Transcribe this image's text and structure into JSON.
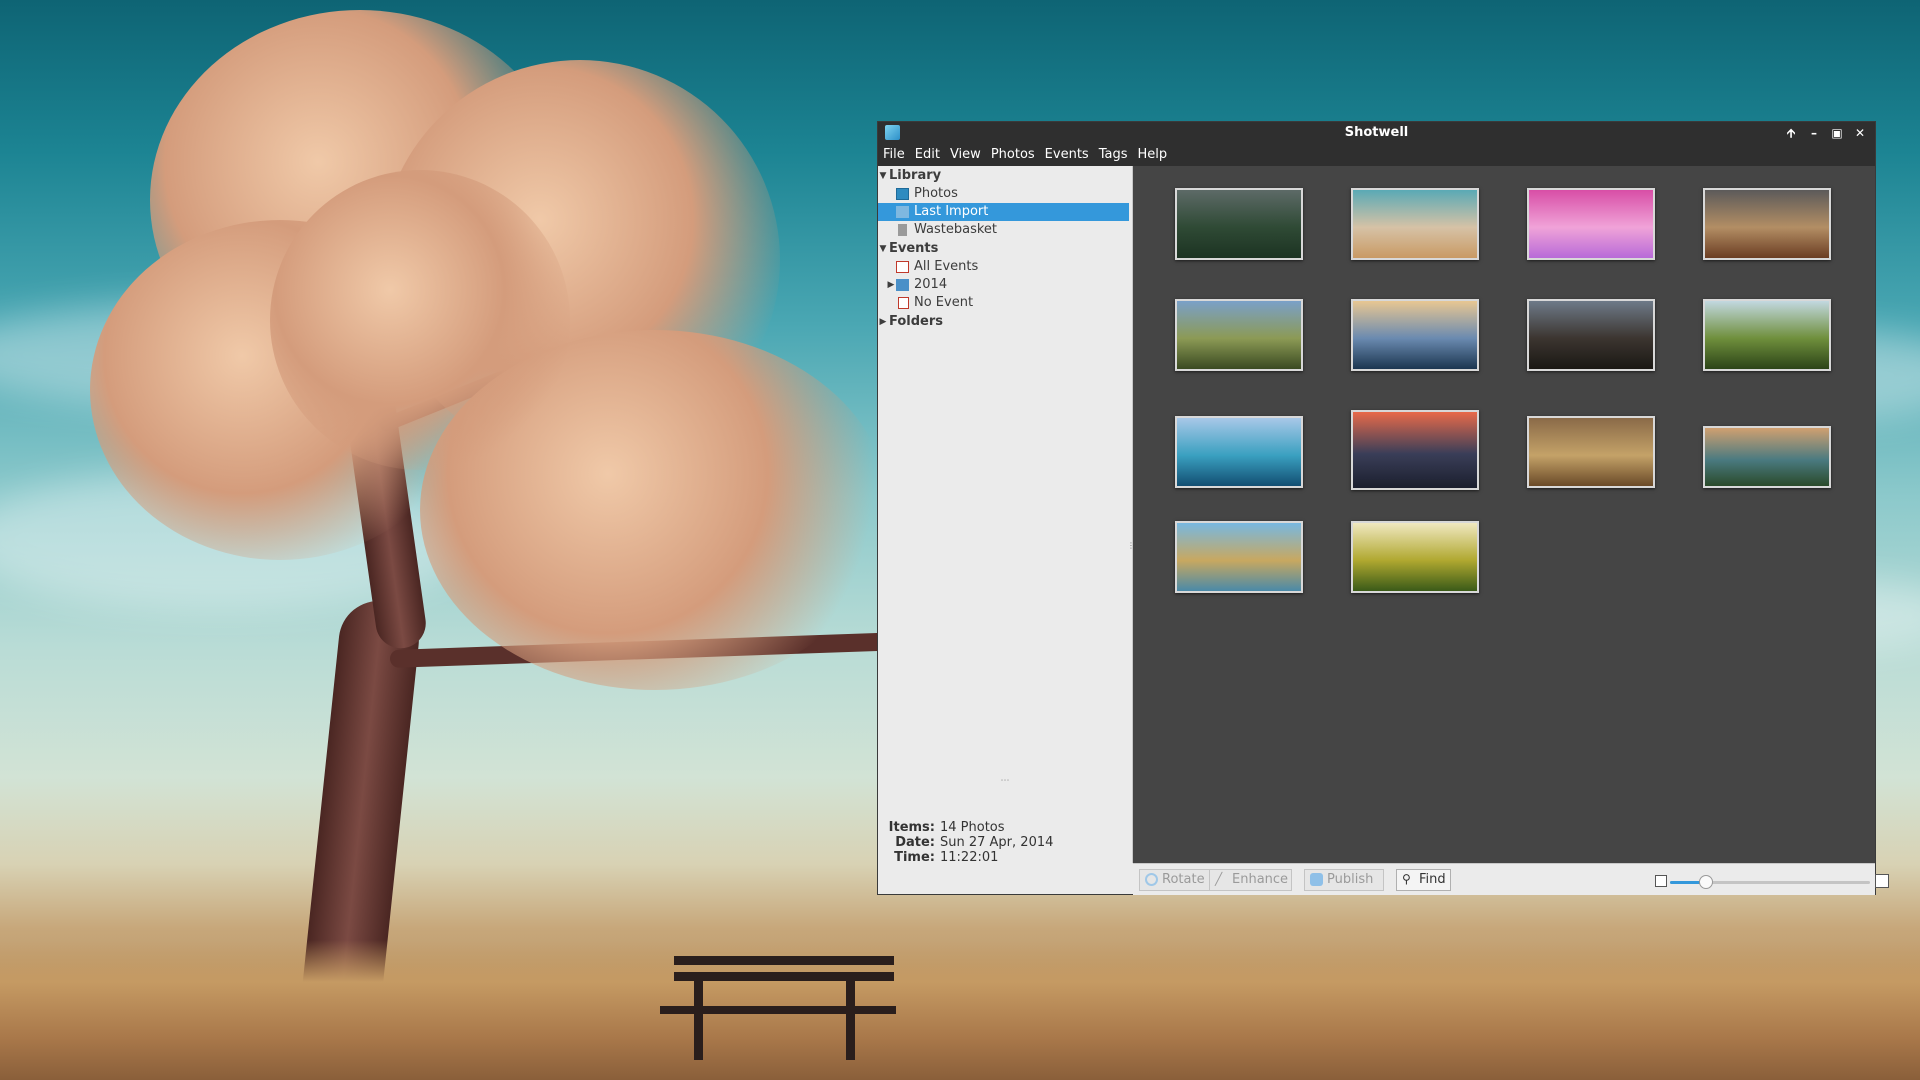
{
  "window": {
    "title": "Shotwell",
    "controls": [
      "keep-above",
      "minimize",
      "maximize",
      "close"
    ]
  },
  "menu": [
    "File",
    "Edit",
    "View",
    "Photos",
    "Events",
    "Tags",
    "Help"
  ],
  "sidebar": {
    "library_label": "Library",
    "library_items": [
      "Photos",
      "Last Import",
      "Wastebasket"
    ],
    "selected": "Last Import",
    "events_label": "Events",
    "events_items": [
      "All Events",
      "2014",
      "No Event"
    ],
    "folders_label": "Folders"
  },
  "info": {
    "items_label": "Items:",
    "items_value": "14 Photos",
    "date_label": "Date:",
    "date_value": "Sun 27 Apr, 2014",
    "time_label": "Time:",
    "time_value": "11:22:01"
  },
  "photos": [
    {
      "name": "misty-forest",
      "colors": [
        "#5d6a67",
        "#2f4a35",
        "#1c3322"
      ]
    },
    {
      "name": "tree-bench",
      "colors": [
        "#5aa9b5",
        "#d6c2a6",
        "#c99a64"
      ]
    },
    {
      "name": "colorful-droplets",
      "colors": [
        "#d84ea6",
        "#f0a3d8",
        "#b86ad8"
      ]
    },
    {
      "name": "canyon-sunset",
      "colors": [
        "#5c5a5a",
        "#b38e64",
        "#6b3d23"
      ]
    },
    {
      "name": "waterfall",
      "colors": [
        "#7aa0c8",
        "#8c9a55",
        "#3a4a22"
      ]
    },
    {
      "name": "rocky-shore",
      "colors": [
        "#e8c792",
        "#6a8ab0",
        "#1c3650"
      ]
    },
    {
      "name": "stormy-cliff",
      "colors": [
        "#6e7a88",
        "#3c3530",
        "#1a1814"
      ]
    },
    {
      "name": "green-valley",
      "colors": [
        "#c2d8e0",
        "#6f8f3c",
        "#2c4418"
      ]
    },
    {
      "name": "mountain-lake",
      "colors": [
        "#a8c8e8",
        "#3aa0c0",
        "#124e72"
      ]
    },
    {
      "name": "city-skyline",
      "colors": [
        "#e86a4a",
        "#3a3e58",
        "#1b1f2e"
      ]
    },
    {
      "name": "desert-storm",
      "colors": [
        "#8a6a48",
        "#c4a268",
        "#6a4a28"
      ]
    },
    {
      "name": "river-valley",
      "colors": [
        "#d0a070",
        "#4a7a80",
        "#2a4a2a"
      ]
    },
    {
      "name": "alpine-reflection",
      "colors": [
        "#78b8e0",
        "#c8a860",
        "#4a8aa8"
      ]
    },
    {
      "name": "golden-meadow",
      "colors": [
        "#f0e8c0",
        "#b0a830",
        "#3a5a18"
      ]
    }
  ],
  "toolbar": {
    "rotate": "Rotate",
    "enhance": "Enhance",
    "publish": "Publish",
    "find": "Find",
    "zoom_level": 0.18
  }
}
